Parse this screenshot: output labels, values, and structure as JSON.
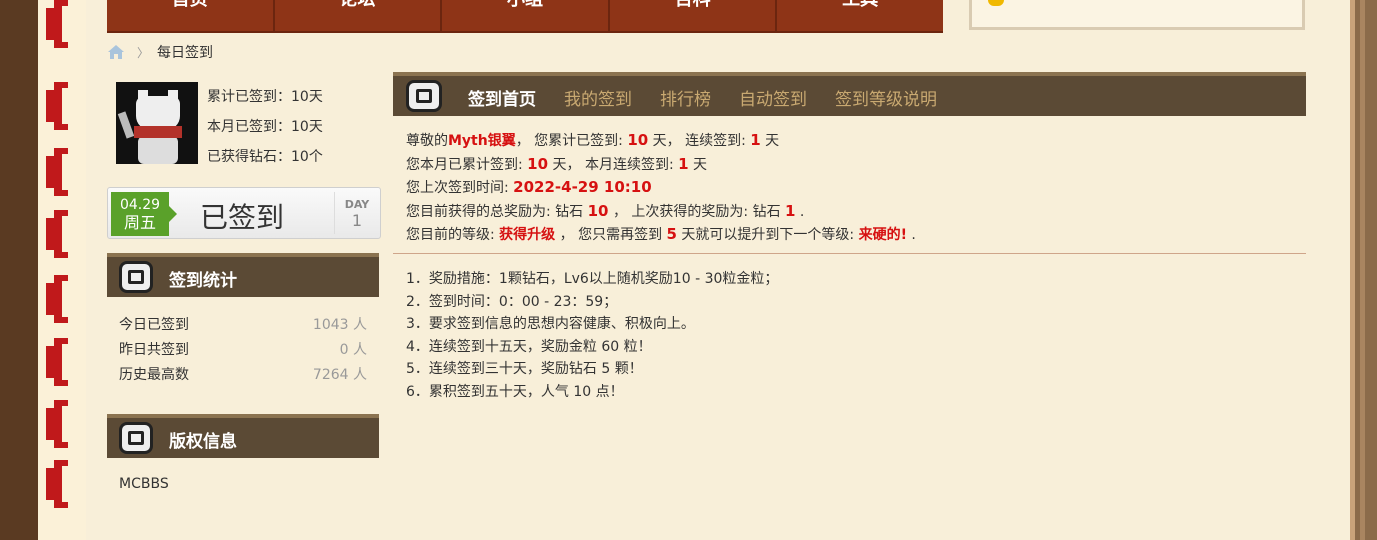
{
  "nav": {
    "items": [
      "首页",
      "论坛",
      "小组",
      "百科",
      "工具"
    ]
  },
  "breadcrumb": {
    "current": "每日签到"
  },
  "user": {
    "stats": [
      "累计已签到：10天",
      "本月已签到：10天",
      "已获得钻石：10个"
    ]
  },
  "sign_button": {
    "date": "04.29",
    "weekday": "周五",
    "label": "已签到",
    "day_label": "DAY",
    "day_value": "1"
  },
  "sign_stats": {
    "title": "签到统计",
    "rows": [
      {
        "label": "今日已签到",
        "value": "1043 人"
      },
      {
        "label": "昨日共签到",
        "value": "0 人"
      },
      {
        "label": "历史最高数",
        "value": "7264 人"
      }
    ]
  },
  "copyright": {
    "title": "版权信息",
    "text": "MCBBS"
  },
  "tabs": [
    "签到首页",
    "我的签到",
    "排行榜",
    "自动签到",
    "签到等级说明"
  ],
  "info": {
    "l1_a": "尊敬的",
    "username": "Myth银翼",
    "l1_b": "，  您累计已签到: ",
    "total_days": "10",
    "l1_c": " 天，  连续签到: ",
    "cont_days": "1",
    "l1_d": " 天",
    "l2_a": "您本月已累计签到: ",
    "month_days": "10",
    "l2_b": " 天，  本月连续签到: ",
    "month_cont": "1",
    "l2_c": " 天",
    "l3_a": "您上次签到时间: ",
    "last_time": "2022-4-29 10:10",
    "l4_a": "您目前获得的总奖励为: 钻石 ",
    "total_reward": "10",
    "l4_b": " ，  上次获得的奖励为: 钻石 ",
    "last_reward": "1",
    "l4_c": " .",
    "l5_a": "您目前的等级: ",
    "level": "获得升级",
    "l5_b": " ，  您只需再签到 ",
    "need_days": "5",
    "l5_c": " 天就可以提升到下一个等级: ",
    "next_level": "来硬的!",
    "l5_d": "   ."
  },
  "rules": [
    "1．奖励措施：1颗钻石，Lv6以上随机奖励10 - 30粒金粒；",
    "2．签到时间：0：00 - 23：59；",
    "3．要求签到信息的思想内容健康、积极向上。",
    "4．连续签到十五天，奖励金粒 60 粒！",
    "5．连续签到三十天，奖励钻石 5 颗！",
    "6．累积签到五十天，人气 10 点！"
  ],
  "colors": {
    "accent_red": "#d61111",
    "nav_brown": "#8e3417",
    "panel_dark": "#5b4a35",
    "sign_green": "#5aa12a"
  }
}
